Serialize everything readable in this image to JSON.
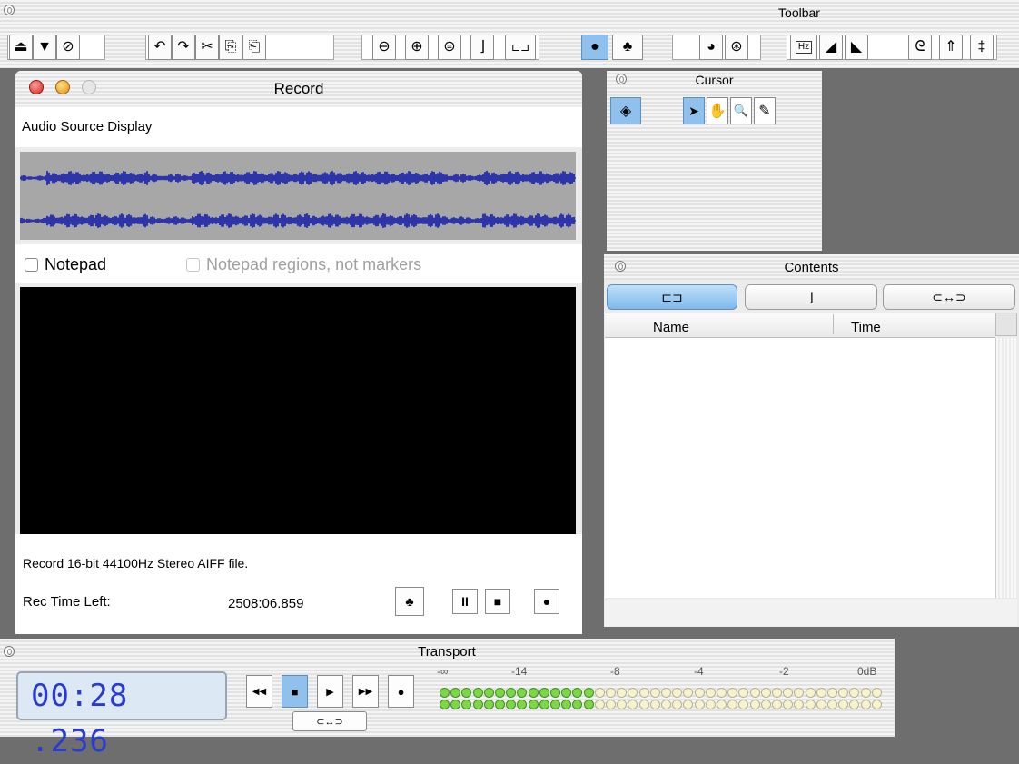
{
  "toolbar": {
    "title": "Toolbar",
    "buttons": {
      "eject": "⏏",
      "down": "▼",
      "nosign": "⊘",
      "undo": "↶",
      "redo": "↷",
      "cut": "✂",
      "copy": "⎘",
      "paste": "⎗",
      "zoom_out": "⊖",
      "zoom_in": "⊕",
      "zoom_fit": "⊜",
      "marker": "⌋",
      "region": "⊏⊐",
      "record": "●",
      "record_setup": "♣",
      "pie": "◕",
      "play_next": "⊛",
      "hz": "Hz",
      "fade_in": "◢",
      "fade_out": "◣",
      "spiral": "ᘓ",
      "upload": "⇑",
      "plus": "‡"
    }
  },
  "record": {
    "title": "Record",
    "source_label": "Audio Source Display",
    "notepad_label": "Notepad",
    "notepad_regions_label": "Notepad regions, not markers",
    "info_text": "Record 16-bit 44100Hz Stereo AIFF file.",
    "time_left_label": "Rec Time Left:",
    "time_left_value": "2508:06.859",
    "pause_label": "II",
    "stop_label": "■",
    "record_label": "●"
  },
  "cursor": {
    "title": "Cursor",
    "tools": [
      "◈",
      "➤",
      "✋",
      "🔍",
      "✎"
    ]
  },
  "contents": {
    "title": "Contents",
    "columns": [
      "Name",
      "Time"
    ],
    "tabs": [
      "⊏⊐",
      "⌋",
      "⊂↔⊃"
    ]
  },
  "transport": {
    "title": "Transport",
    "time": "00:28 .236",
    "buttons": [
      "◀◀",
      "■",
      "▶",
      "▶▶",
      "●"
    ],
    "loop_label": "⊂↔⊃",
    "meter_ticks": [
      "-∞",
      "-14",
      "-8",
      "-4",
      "-2",
      "0dB"
    ],
    "meter_level": 0.35
  },
  "colors": {
    "waveform": "#2e35a8",
    "selected": "#8fc1ec",
    "lcd_text": "#2a3bd0",
    "led_on": "#7ed548"
  }
}
